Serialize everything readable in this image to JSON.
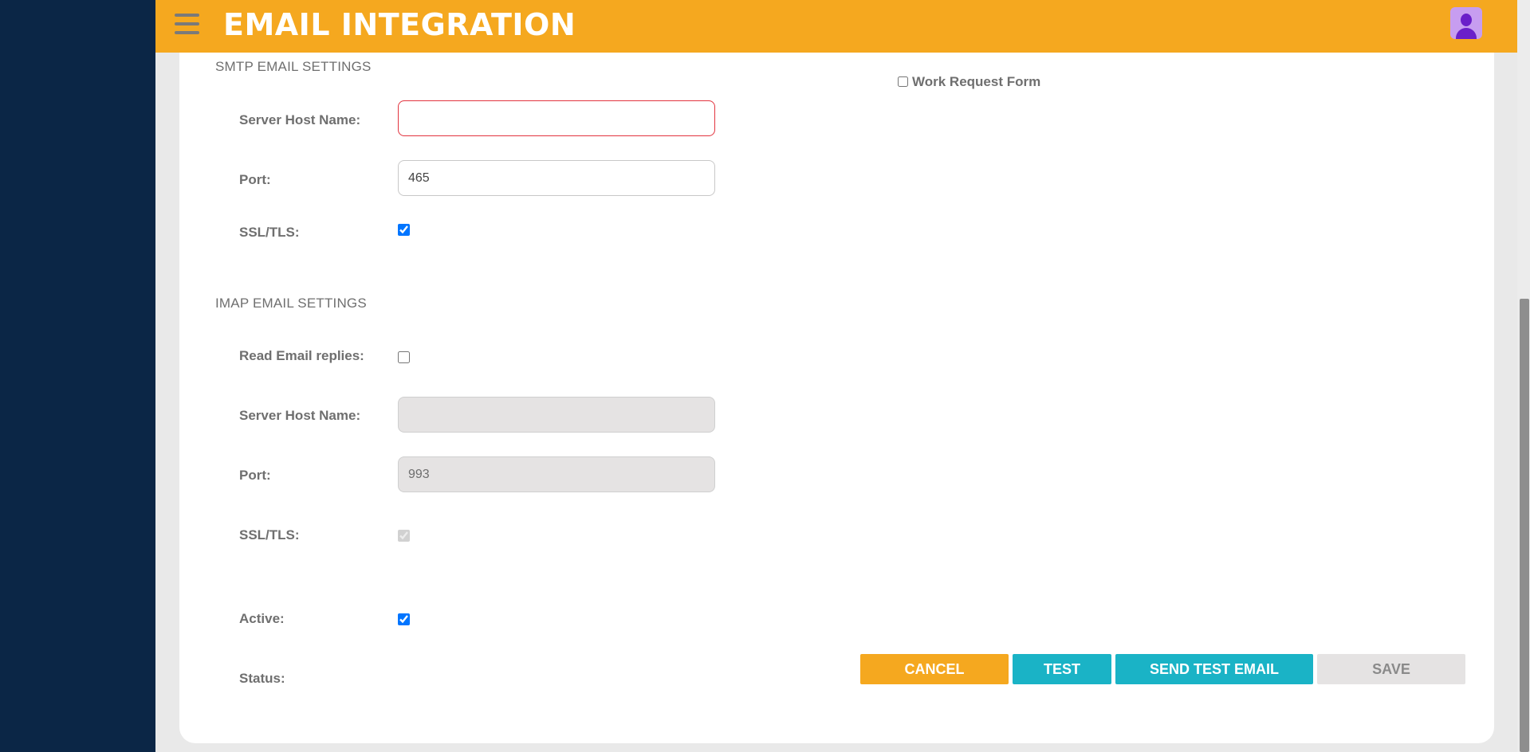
{
  "header": {
    "title": "EMAIL INTEGRATION"
  },
  "smtp": {
    "section_title": "SMTP EMAIL SETTINGS",
    "host_label": "Server Host Name:",
    "host_value": "",
    "port_label": "Port:",
    "port_value": "465",
    "ssl_label": "SSL/TLS:",
    "ssl_checked": true
  },
  "work_request": {
    "label": "Work Request Form",
    "checked": false
  },
  "imap": {
    "section_title": "IMAP EMAIL SETTINGS",
    "read_replies_label": "Read Email replies:",
    "read_replies_checked": false,
    "host_label": "Server Host Name:",
    "host_value": "",
    "port_label": "Port:",
    "port_value": "993",
    "ssl_label": "SSL/TLS:",
    "ssl_checked": true
  },
  "status_block": {
    "active_label": "Active:",
    "active_checked": true,
    "status_label": "Status:"
  },
  "actions": {
    "cancel": "CANCEL",
    "test": "TEST",
    "send_test_email": "SEND TEST EMAIL",
    "save": "SAVE"
  },
  "colors": {
    "header": "#f5a81f",
    "sidebar": "#0b2646",
    "primary_button": "#1ab3c6",
    "error_border": "#e2343f"
  }
}
